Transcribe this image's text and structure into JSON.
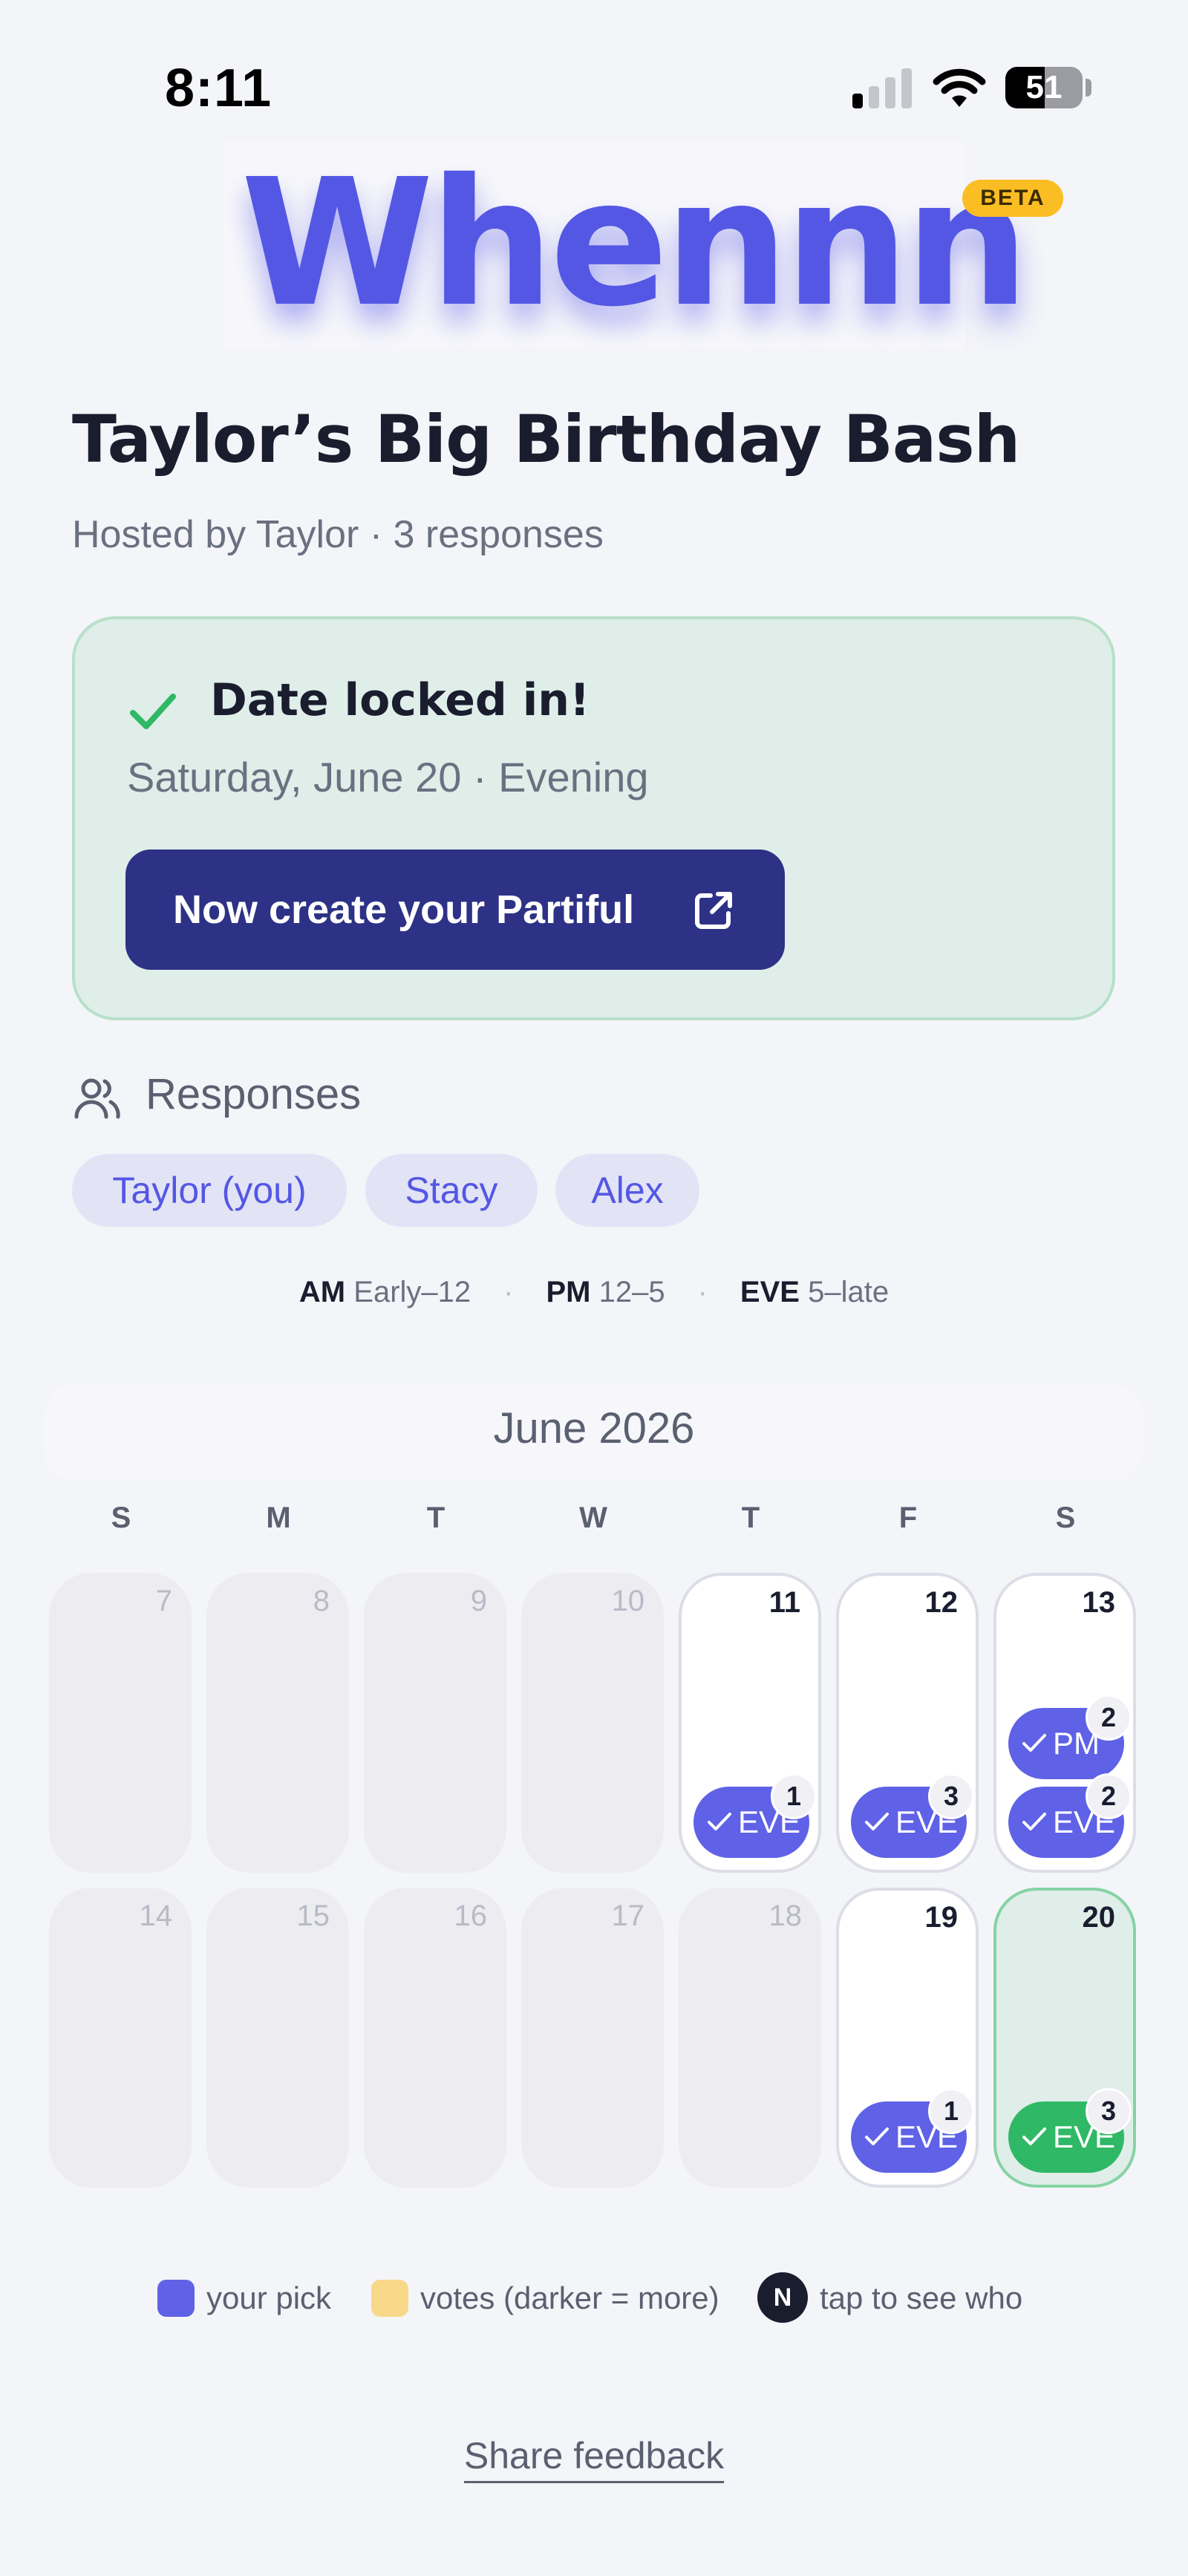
{
  "status_bar": {
    "time": "8:11",
    "battery": "51"
  },
  "brand": {
    "logo": "Whennn",
    "badge": "BETA"
  },
  "event": {
    "title": "Taylor’s Big Birthday Bash",
    "subtitle": "Hosted by Taylor · 3 responses"
  },
  "locked": {
    "title": "Date locked in!",
    "date": "Saturday, June 20 · Evening",
    "button": "Now create your Partiful"
  },
  "responses": {
    "label": "Responses",
    "people": [
      "Taylor (you)",
      "Stacy",
      "Alex"
    ]
  },
  "slots": {
    "am_key": "AM",
    "am_val": "Early–12",
    "pm_key": "PM",
    "pm_val": "12–5",
    "eve_key": "EVE",
    "eve_val": "5–late"
  },
  "calendar": {
    "month": "June 2026",
    "weekdays": [
      "S",
      "M",
      "T",
      "W",
      "T",
      "F",
      "S"
    ],
    "week1": [
      "7",
      "8",
      "9",
      "10",
      "11",
      "12",
      "13"
    ],
    "week2": [
      "14",
      "15",
      "16",
      "17",
      "18",
      "19",
      "20"
    ],
    "pill_labels": {
      "pm": "PM",
      "eve": "EVE"
    },
    "counts": {
      "d11_eve": "1",
      "d12_eve": "3",
      "d13_pm": "2",
      "d13_eve": "2",
      "d19_eve": "1",
      "d20_eve": "3"
    }
  },
  "legend": {
    "your_pick": "your pick",
    "votes": "votes (darker = more)",
    "n_badge": "N",
    "tap": "tap to see who"
  },
  "footer": {
    "feedback": "Share feedback"
  },
  "colors": {
    "accent": "#5457e4",
    "locked_green": "#2fb865",
    "dark_button": "#2d3286",
    "beta": "#fbbd24"
  }
}
